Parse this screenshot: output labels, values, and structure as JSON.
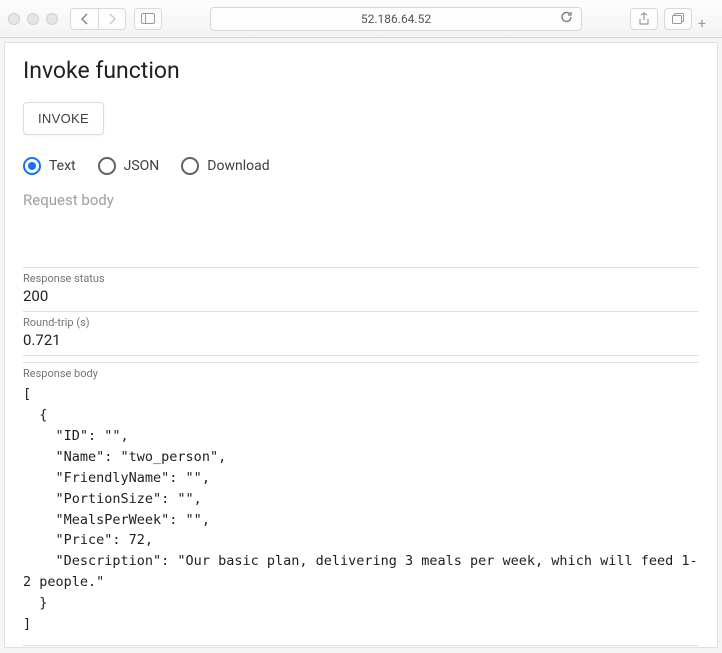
{
  "browser": {
    "address": "52.186.64.52"
  },
  "page": {
    "title": "Invoke function",
    "invoke_button": "INVOKE",
    "radios": {
      "text": "Text",
      "json": "JSON",
      "download": "Download"
    },
    "request_body_placeholder": "Request body",
    "response_status_label": "Response status",
    "response_status": "200",
    "round_trip_label": "Round-trip (s)",
    "round_trip": "0.721",
    "response_body_label": "Response body",
    "response_body": "[\n  {\n    \"ID\": \"\",\n    \"Name\": \"two_person\",\n    \"FriendlyName\": \"\",\n    \"PortionSize\": \"\",\n    \"MealsPerWeek\": \"\",\n    \"Price\": 72,\n    \"Description\": \"Our basic plan, delivering 3 meals per week, which will feed 1-2 people.\"\n  }\n]"
  }
}
